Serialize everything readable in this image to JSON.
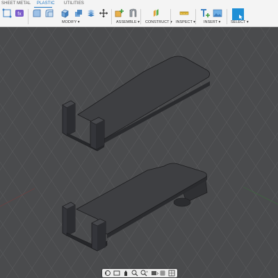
{
  "ribbon": {
    "tabs": [
      {
        "label": "SHEET METAL",
        "active": false
      },
      {
        "label": "PLASTIC",
        "active": true
      },
      {
        "label": "UTILITIES",
        "active": false
      }
    ],
    "groups": {
      "modify": "MODIFY ▾",
      "assemble": "ASSEMBLE ▾",
      "construct": "CONSTRUCT ▾",
      "inspect": "INSPECT ▾",
      "insert": "INSERT ▾",
      "select": "SELECT ▾"
    },
    "icons": [
      "sketch-icon",
      "parameters-icon",
      "fillet-icon",
      "shell-icon",
      "press-pull-icon",
      "combine-icon",
      "move-icon",
      "new-component-icon",
      "joint-icon",
      "offset-plane-icon",
      "measure-icon",
      "insert-text-icon",
      "insert-image-icon",
      "select-icon"
    ]
  },
  "viewport": {
    "background": "#4a4b4d",
    "grid_color": "#5a5b5d",
    "part_color": "#3e3f42",
    "edge_color": "#1c1c1e",
    "objects": [
      "upper-bracket-part",
      "lower-bracket-part"
    ]
  },
  "nav_bar": {
    "icons": [
      "orbit-icon",
      "look-at-icon",
      "pan-icon",
      "zoom-icon",
      "fit-icon",
      "display-mode-icon",
      "grid-icon",
      "viewports-icon"
    ]
  },
  "colors": {
    "accent": "#1d75c2",
    "ribbon_bg": "#f4f4f4"
  }
}
